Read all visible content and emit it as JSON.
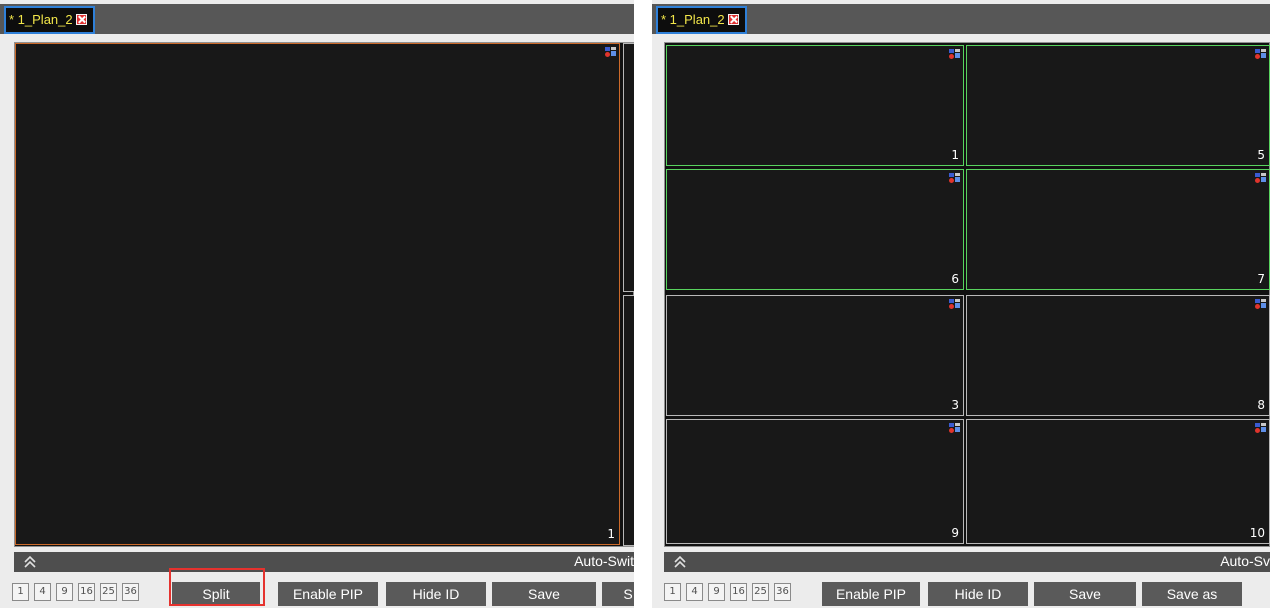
{
  "left": {
    "tab_title": "* 1_Plan_2",
    "screens": [
      {
        "num": "1"
      }
    ],
    "autobar_label": "Auto-Swit",
    "layout_buttons": [
      "1",
      "4",
      "9",
      "16",
      "25",
      "36"
    ],
    "actions": {
      "split": "Split",
      "pip": "Enable PIP",
      "hide_id": "Hide ID",
      "save": "Save",
      "save_partial": "S"
    }
  },
  "right": {
    "tab_title": "* 1_Plan_2",
    "screens": [
      {
        "num": "1"
      },
      {
        "num": "5"
      },
      {
        "num": "6"
      },
      {
        "num": "7"
      },
      {
        "num": "3"
      },
      {
        "num": "8"
      },
      {
        "num": "9"
      },
      {
        "num": "10"
      }
    ],
    "autobar_label": "Auto-Sv",
    "layout_buttons": [
      "1",
      "4",
      "9",
      "16",
      "25",
      "36"
    ],
    "actions": {
      "pip": "Enable PIP",
      "hide_id": "Hide ID",
      "save": "Save",
      "save_as": "Save as"
    }
  },
  "colors": {
    "tab_text": "#f2e64a",
    "tab_border": "#2f80d8",
    "selected_red": "#cc6a2a",
    "selected_green": "#58d35e",
    "highlight": "#e5322e"
  }
}
